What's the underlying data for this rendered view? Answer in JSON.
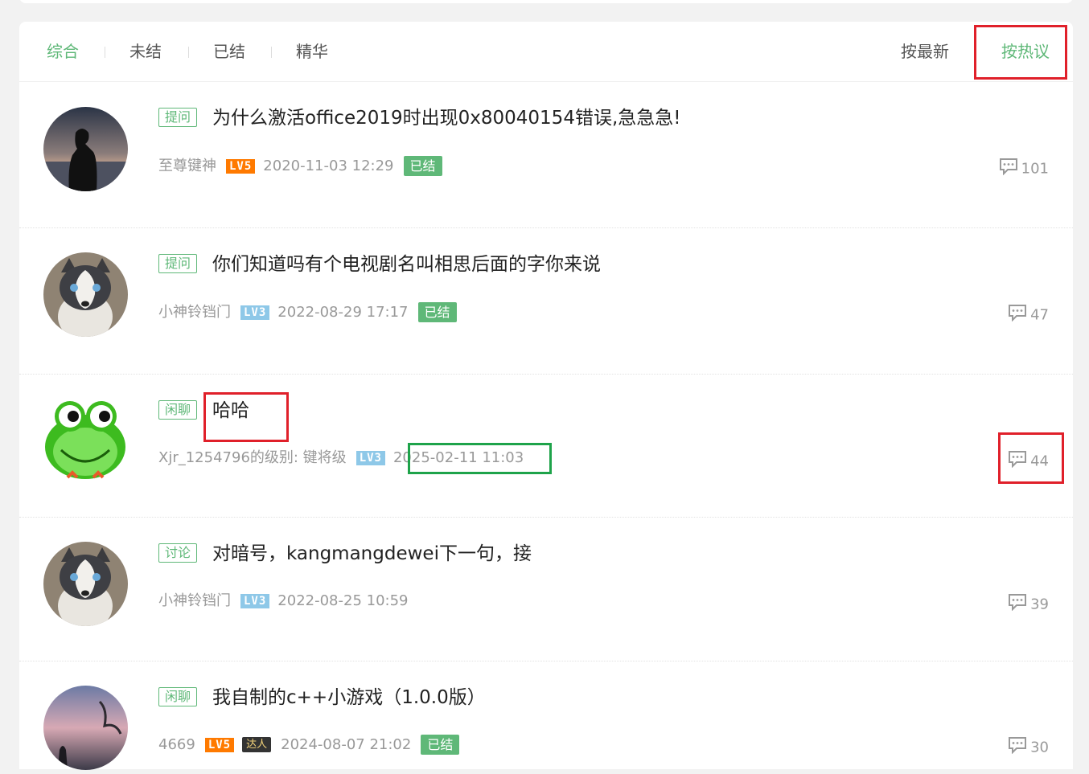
{
  "tabs": [
    "综合",
    "未结",
    "已结",
    "精华"
  ],
  "sort": {
    "latest": "按最新",
    "hottest": "按热议"
  },
  "posts": [
    {
      "tag": "提问",
      "title": "为什么激活office2019时出现0x80040154错误,急急急!",
      "author": "至尊键神",
      "level": "LV5",
      "time": "2020-11-03 12:29",
      "status": "已结",
      "comments": "101"
    },
    {
      "tag": "提问",
      "title": "你们知道吗有个电视剧名叫相思后面的字你来说",
      "author": "小神铃铛门",
      "level": "LV3",
      "time": "2022-08-29 17:17",
      "status": "已结",
      "comments": "47"
    },
    {
      "tag": "闲聊",
      "title": "哈哈",
      "author": "Xjr_1254796的级别:   键将级",
      "level": "LV3",
      "time": "2025-02-11 11:03",
      "comments": "44"
    },
    {
      "tag": "讨论",
      "title": "对暗号，kangmangdewei下一句，接",
      "author": "小神铃铛门",
      "level": "LV3",
      "time": "2022-08-25 10:59",
      "comments": "39"
    },
    {
      "tag": "闲聊",
      "title": "我自制的c++小游戏（1.0.0版）",
      "author": "4669",
      "level": "LV5",
      "badge": "达人",
      "time": "2024-08-07 21:02",
      "status": "已结",
      "comments": "30"
    }
  ],
  "colors": {
    "accent": "#5FB878",
    "highlight_red": "#e0202a",
    "highlight_green": "#1ea34a"
  }
}
